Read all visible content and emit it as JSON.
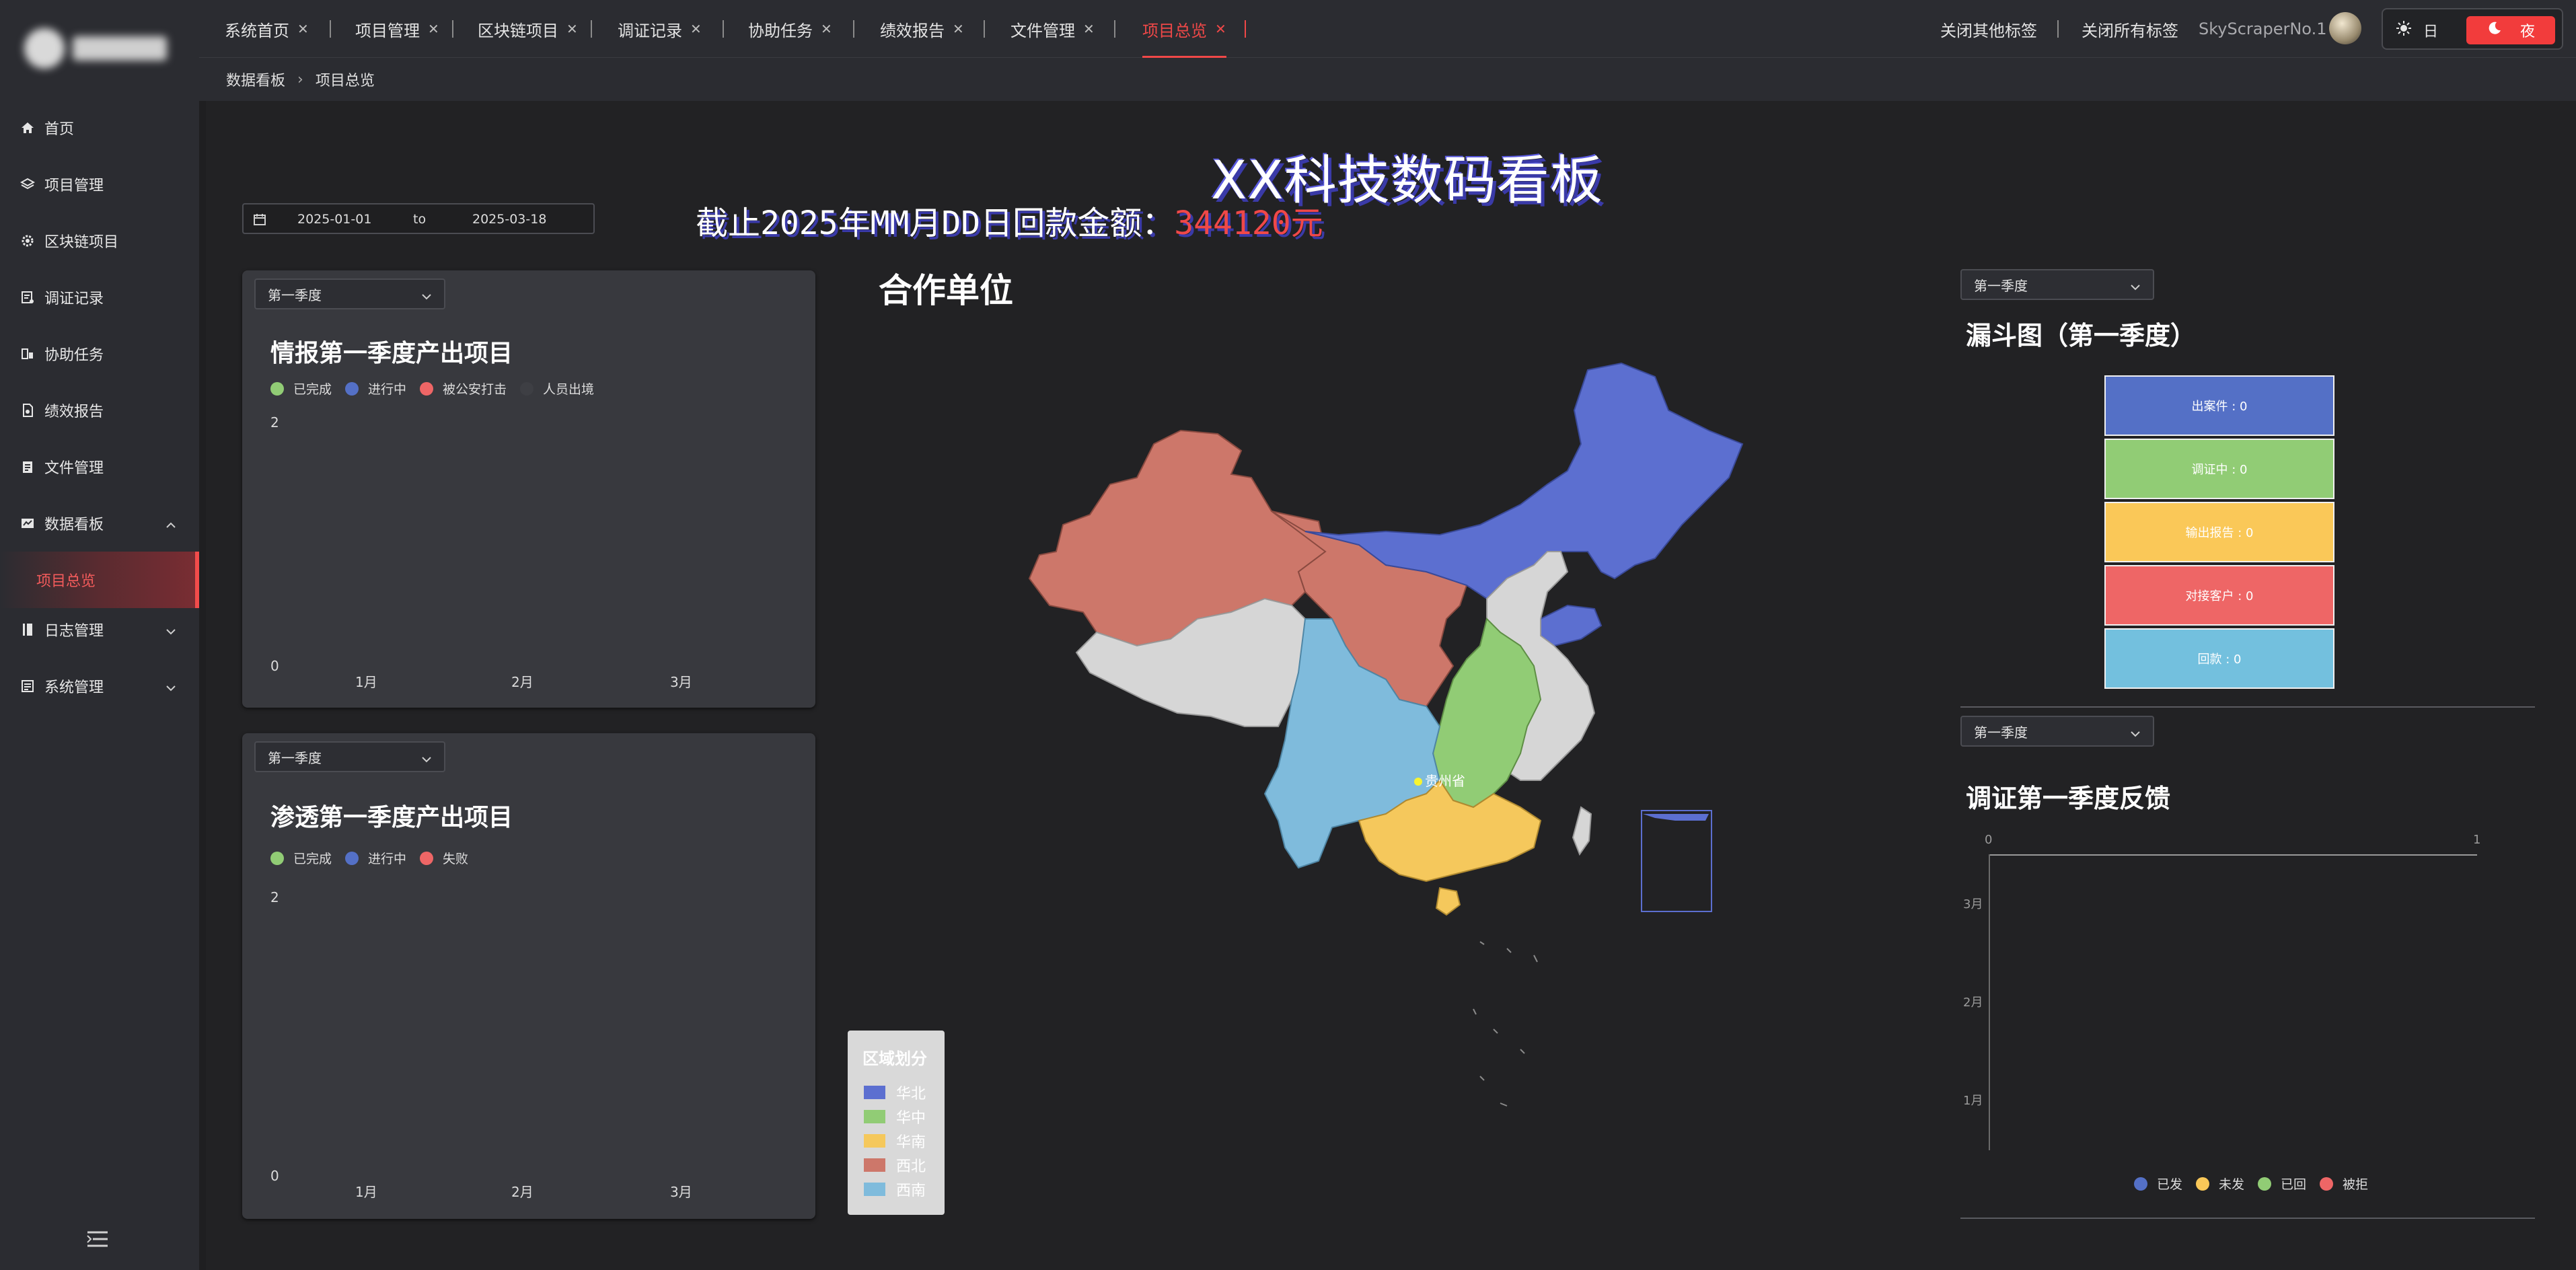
{
  "sidebar": {
    "items": [
      {
        "label": "首页",
        "icon": "home-icon"
      },
      {
        "label": "项目管理",
        "icon": "layers-icon"
      },
      {
        "label": "区块链项目",
        "icon": "settings-icon"
      },
      {
        "label": "调证记录",
        "icon": "record-icon"
      },
      {
        "label": "协助任务",
        "icon": "task-icon"
      },
      {
        "label": "绩效报告",
        "icon": "report-icon"
      },
      {
        "label": "文件管理",
        "icon": "file-icon"
      },
      {
        "label": "数据看板",
        "icon": "dashboard-icon"
      },
      {
        "label": "项目总览",
        "icon": ""
      },
      {
        "label": "日志管理",
        "icon": "log-icon"
      },
      {
        "label": "系统管理",
        "icon": "system-icon"
      }
    ]
  },
  "tabs": [
    {
      "label": "系统首页"
    },
    {
      "label": "项目管理"
    },
    {
      "label": "区块链项目"
    },
    {
      "label": "调证记录"
    },
    {
      "label": "协助任务"
    },
    {
      "label": "绩效报告"
    },
    {
      "label": "文件管理"
    },
    {
      "label": "项目总览"
    }
  ],
  "header": {
    "close_others": "关闭其他标签",
    "close_all": "关闭所有标签",
    "username": "SkyScraperNo.1",
    "theme_day": "日",
    "theme_night": "夜"
  },
  "breadcrumb": {
    "parent": "数据看板",
    "current": "项目总览"
  },
  "dashboard": {
    "title": "XX科技数码看板",
    "subtitle_prefix": "截止2025年MM月DD日回款金额：",
    "amount": "344120元",
    "date_start": "2025-01-01",
    "date_to": "to",
    "date_end": "2025-03-18"
  },
  "intel_panel": {
    "select": "第一季度",
    "title": "情报第一季度产出项目",
    "legend": [
      "已完成",
      "进行中",
      "被公安打击",
      "人员出境"
    ],
    "y_top": "2",
    "y_bottom": "0",
    "x_labels": [
      "1月",
      "2月",
      "3月"
    ]
  },
  "pentest_panel": {
    "select": "第一季度",
    "title": "渗透第一季度产出项目",
    "legend": [
      "已完成",
      "进行中",
      "失败"
    ],
    "y_top": "2",
    "y_bottom": "0",
    "x_labels": [
      "1月",
      "2月",
      "3月"
    ]
  },
  "map": {
    "title": "合作单位",
    "marker_label": "贵州省",
    "legend_title": "区域划分",
    "regions": [
      "华北",
      "华中",
      "华南",
      "西北",
      "西南"
    ]
  },
  "funnel": {
    "select": "第一季度",
    "title": "漏斗图（第一季度）",
    "steps": [
      "出案件 : 0",
      "调证中 : 0",
      "输出报告 : 0",
      "对接客户 : 0",
      "回款 : 0"
    ]
  },
  "feedback": {
    "select": "第一季度",
    "title": "调证第一季度反馈",
    "x_ticks": [
      "0",
      "1"
    ],
    "y_labels": [
      "3月",
      "2月",
      "1月"
    ],
    "legend": [
      "已发",
      "未发",
      "已回",
      "被拒"
    ]
  },
  "colors": {
    "accent": "#f04848",
    "green": "#91cc75",
    "blue": "#5470c6",
    "red": "#ee6666",
    "gray": "#3e3f44",
    "yellow": "#fac858",
    "light_blue": "#73c0de",
    "map_north": "#5c6fd0",
    "map_central": "#91cc75",
    "map_south": "#f5c85c",
    "map_northwest": "#cd776a",
    "map_southwest": "#7fbbdc",
    "map_other": "#d6d6d6"
  }
}
